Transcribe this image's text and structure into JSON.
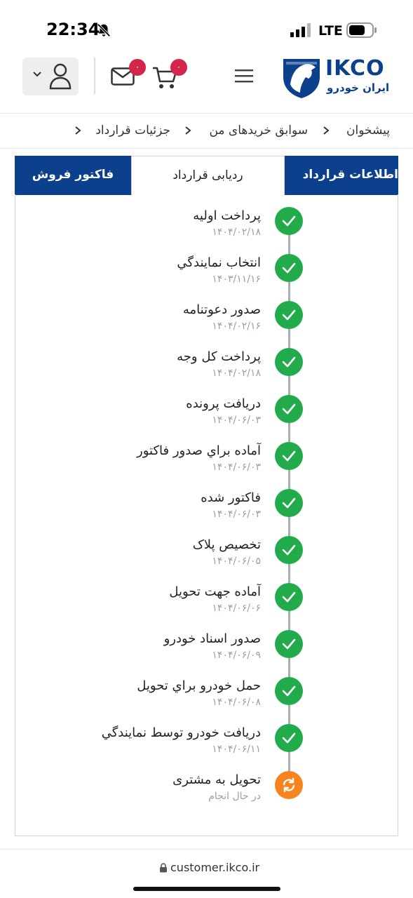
{
  "status_bar": {
    "time": "22:34",
    "network": "LTE"
  },
  "header": {
    "mail_badge": "۰",
    "cart_badge": "۰",
    "logo_text": "IKCO",
    "logo_subtext": "ایران خودرو"
  },
  "breadcrumb": {
    "items": [
      "پیشخوان",
      "سوابق خریدهای من",
      "جزئیات قرارداد"
    ]
  },
  "tabs": {
    "invoice": "فاکتور فروش",
    "tracking": "ردیابی قرارداد",
    "info": "اطلاعات قرارداد"
  },
  "steps": [
    {
      "title": "پرداخت اولیه",
      "date": "۱۴۰۴/۰۲/۱۸",
      "status": "done"
    },
    {
      "title": "انتخاب نمايندگي",
      "date": "۱۴۰۳/۱۱/۱۶",
      "status": "done"
    },
    {
      "title": "صدور دعوتنامه",
      "date": "۱۴۰۴/۰۲/۱۶",
      "status": "done"
    },
    {
      "title": "پرداخت کل وجه",
      "date": "۱۴۰۴/۰۲/۱۸",
      "status": "done"
    },
    {
      "title": "دريافت پرونده",
      "date": "۱۴۰۴/۰۶/۰۳",
      "status": "done"
    },
    {
      "title": "آماده براي صدور فاكتور",
      "date": "۱۴۰۴/۰۶/۰۳",
      "status": "done"
    },
    {
      "title": "فاكتور شده",
      "date": "۱۴۰۴/۰۶/۰۳",
      "status": "done"
    },
    {
      "title": "تخصيص پلاک",
      "date": "۱۴۰۴/۰۶/۰۵",
      "status": "done"
    },
    {
      "title": "آماده جهت تحويل",
      "date": "۱۴۰۴/۰۶/۰۶",
      "status": "done"
    },
    {
      "title": "صدور اسناد خودرو",
      "date": "۱۴۰۴/۰۶/۰۹",
      "status": "done"
    },
    {
      "title": "حمل خودرو براي تحويل",
      "date": "۱۴۰۴/۰۶/۰۸",
      "status": "done"
    },
    {
      "title": "دريافت خودرو توسط نمايندگي",
      "date": "۱۴۰۴/۰۶/۱۱",
      "status": "done"
    },
    {
      "title": "تحویل به مشتری",
      "date": "در حال انجام",
      "status": "in-progress"
    }
  ],
  "browser": {
    "url": "customer.ikco.ir"
  },
  "colors": {
    "brand_blue": "#0c3f8c",
    "done_green": "#22ab4a",
    "progress_orange": "#f7841f",
    "badge_red": "#d3264a"
  }
}
